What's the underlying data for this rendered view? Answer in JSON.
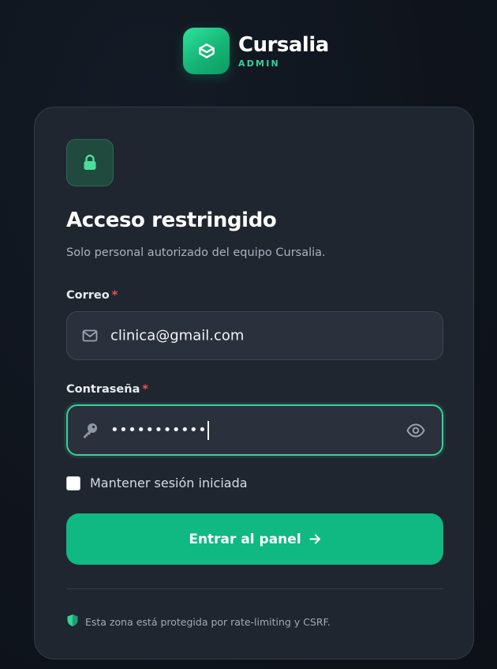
{
  "brand": {
    "name": "Cursalia",
    "subtitle": "ADMIN",
    "logo_icon": "box-icon",
    "accent_color": "#10b981"
  },
  "card": {
    "badge_icon": "lock-icon",
    "title": "Acceso restringido",
    "subtitle": "Solo personal autorizado del equipo Cursalia."
  },
  "email": {
    "label": "Correo",
    "required_mark": "*",
    "value": "clinica@gmail.com",
    "icon": "mail-icon"
  },
  "password": {
    "label": "Contraseña",
    "required_mark": "*",
    "value_masked": "•••••••••••",
    "icon": "key-icon",
    "toggle_icon": "eye-icon",
    "focused": true
  },
  "remember": {
    "label": "Mantener sesión iniciada",
    "checked": false
  },
  "submit": {
    "label": "Entrar al panel",
    "icon": "arrow-right-icon"
  },
  "footer": {
    "icon": "shield-icon",
    "text": "Esta zona está protegida por rate-limiting y CSRF."
  }
}
